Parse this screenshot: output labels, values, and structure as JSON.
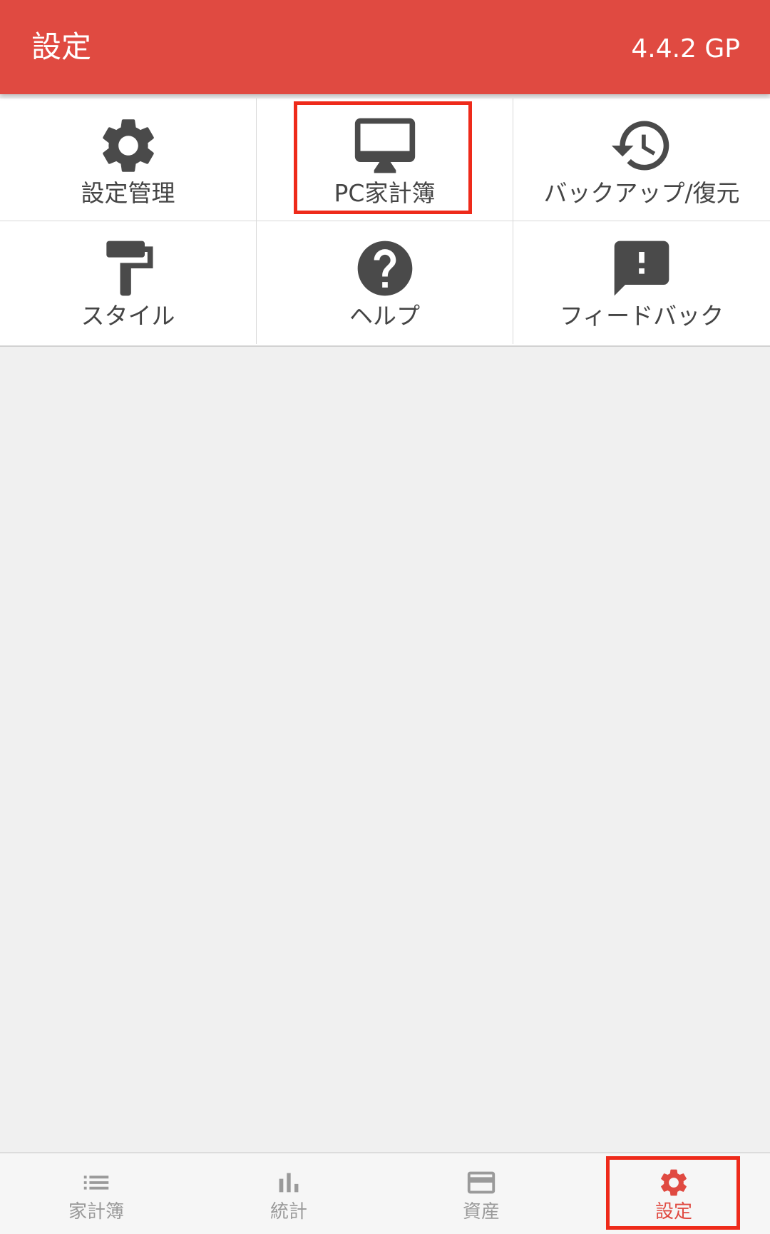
{
  "header": {
    "title": "設定",
    "version": "4.4.2 GP"
  },
  "menu": {
    "items": [
      {
        "label": "設定管理",
        "icon": "gear-icon"
      },
      {
        "label": "PC家計簿",
        "icon": "desktop-monitor-icon",
        "highlighted": true
      },
      {
        "label": "バックアップ/復元",
        "icon": "history-icon"
      },
      {
        "label": "スタイル",
        "icon": "paint-roller-icon"
      },
      {
        "label": "ヘルプ",
        "icon": "help-circle-icon"
      },
      {
        "label": "フィードバック",
        "icon": "feedback-icon"
      }
    ]
  },
  "bottom_nav": {
    "items": [
      {
        "label": "家計簿",
        "icon": "list-icon",
        "active": false
      },
      {
        "label": "統計",
        "icon": "bar-chart-icon",
        "active": false
      },
      {
        "label": "資産",
        "icon": "credit-card-icon",
        "active": false
      },
      {
        "label": "設定",
        "icon": "gear-icon",
        "active": true,
        "highlighted": true
      }
    ]
  },
  "colors": {
    "accent": "#e04a41",
    "highlight_box": "#ee2a1a",
    "icon_dark": "#4a4a4a",
    "inactive_nav": "#9a9a9a",
    "background": "#f0f0f0"
  }
}
